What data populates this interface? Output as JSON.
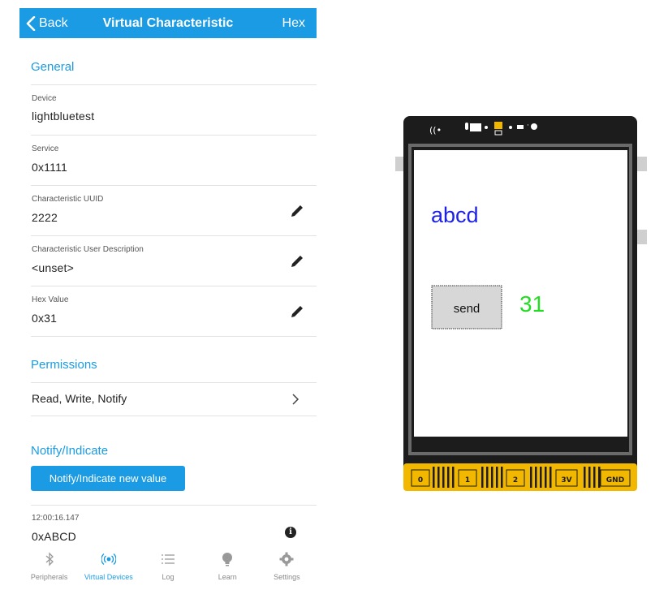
{
  "phone": {
    "nav": {
      "back_label": "Back",
      "title": "Virtual Characteristic",
      "hex_label": "Hex"
    },
    "general": {
      "heading": "General",
      "device_label": "Device",
      "device_value": "lightbluetest",
      "service_label": "Service",
      "service_value": "0x1111",
      "uuid_label": "Characteristic UUID",
      "uuid_value": "2222",
      "desc_label": "Characteristic User Description",
      "desc_value": "<unset>",
      "hex_label": "Hex Value",
      "hex_value": "0x31"
    },
    "permissions": {
      "heading": "Permissions",
      "value": "Read, Write, Notify"
    },
    "notify": {
      "heading": "Notify/Indicate",
      "button_label": "Notify/Indicate new value",
      "log_time": "12:00:16.147",
      "log_value": "0xABCD"
    },
    "tabs": [
      {
        "label": "Peripherals",
        "icon": "bluetooth-icon",
        "active": false
      },
      {
        "label": "Virtual Devices",
        "icon": "broadcast-icon",
        "active": true
      },
      {
        "label": "Log",
        "icon": "list-icon",
        "active": false
      },
      {
        "label": "Learn",
        "icon": "lightbulb-icon",
        "active": false
      },
      {
        "label": "Settings",
        "icon": "gear-icon",
        "active": false
      }
    ],
    "accent_color": "#1a9be3"
  },
  "device": {
    "screen_text": "abcd",
    "screen_text_color": "#1e22e6",
    "send_button_label": "send",
    "value_display": "31",
    "value_color": "#22dd22",
    "pins": [
      "0",
      "1",
      "2",
      "3V",
      "GND"
    ],
    "board_color": "#1c1c1c",
    "edge_color": "#f2b800"
  }
}
